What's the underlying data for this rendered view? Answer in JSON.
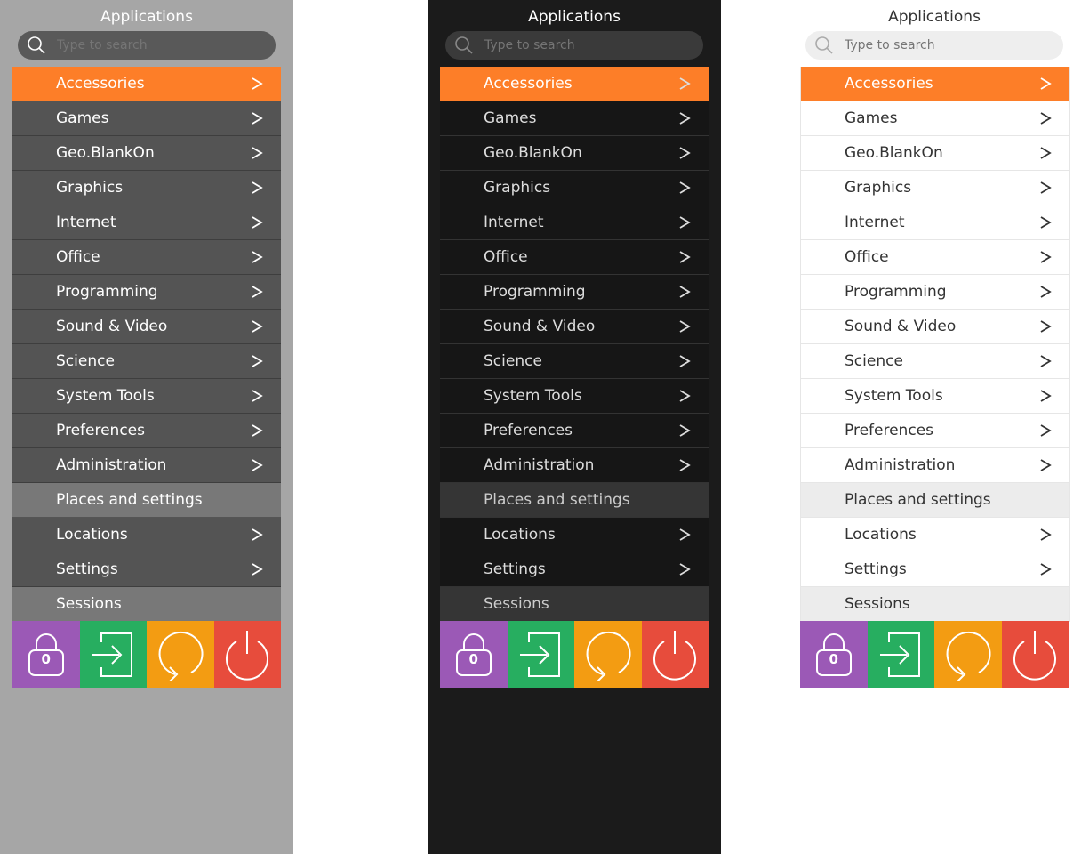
{
  "colors": {
    "accent": "#fd7e28",
    "lock": "#9b59b6",
    "login": "#27ae60",
    "restart": "#f39c12",
    "power": "#e74c3c"
  },
  "title": "Applications",
  "search": {
    "placeholder": "Type to search"
  },
  "categories": [
    {
      "label": "Accessories",
      "active": true
    },
    {
      "label": "Games"
    },
    {
      "label": "Geo.BlankOn"
    },
    {
      "label": "Graphics"
    },
    {
      "label": "Internet"
    },
    {
      "label": "Office"
    },
    {
      "label": "Programming"
    },
    {
      "label": "Sound & Video"
    },
    {
      "label": "Science"
    },
    {
      "label": "System Tools"
    },
    {
      "label": "Preferences"
    },
    {
      "label": "Administration"
    }
  ],
  "places_header": "Places and settings",
  "places": [
    {
      "label": "Locations"
    },
    {
      "label": "Settings"
    }
  ],
  "sessions_header": "Sessions",
  "lock_count": "0",
  "themes": [
    "gray",
    "dark",
    "light"
  ],
  "icons": [
    "search-icon",
    "chevron-right-icon",
    "lock-icon",
    "login-icon",
    "restart-icon",
    "power-icon"
  ]
}
